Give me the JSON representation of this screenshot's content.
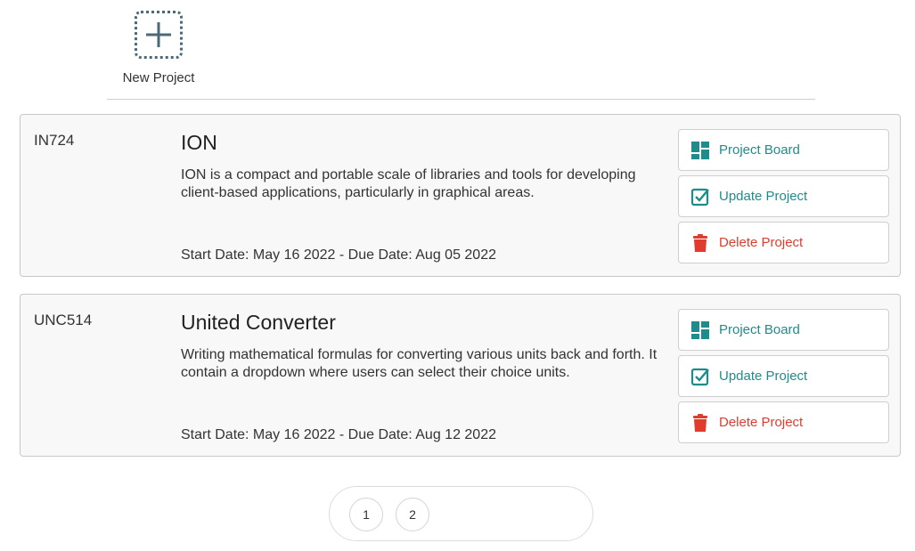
{
  "new_project": {
    "label": "New Project",
    "icon": "plus-icon"
  },
  "colors": {
    "teal": "#1f8c8c",
    "red": "#e03c2e",
    "dotted_border": "#4a6a7a"
  },
  "projects": [
    {
      "id": "IN724",
      "title": "ION",
      "description": "ION is a compact and portable scale of libraries and tools for developing client-based applications, particularly in graphical areas.",
      "dates": "Start Date: May 16 2022 - Due Date: Aug 05 2022",
      "actions": {
        "board": {
          "label": "Project Board",
          "icon": "dashboard-icon"
        },
        "update": {
          "label": "Update Project",
          "icon": "check-square-icon"
        },
        "delete": {
          "label": "Delete Project",
          "icon": "trash-icon"
        }
      }
    },
    {
      "id": "UNC514",
      "title": "United Converter",
      "description": "Writing mathematical formulas for converting various units back and forth. It contain a dropdown where users can select their choice units.",
      "dates": "Start Date: May 16 2022 - Due Date: Aug 12 2022",
      "actions": {
        "board": {
          "label": "Project Board",
          "icon": "dashboard-icon"
        },
        "update": {
          "label": "Update Project",
          "icon": "check-square-icon"
        },
        "delete": {
          "label": "Delete Project",
          "icon": "trash-icon"
        }
      }
    }
  ],
  "pagination": {
    "pages": [
      "1",
      "2"
    ]
  }
}
